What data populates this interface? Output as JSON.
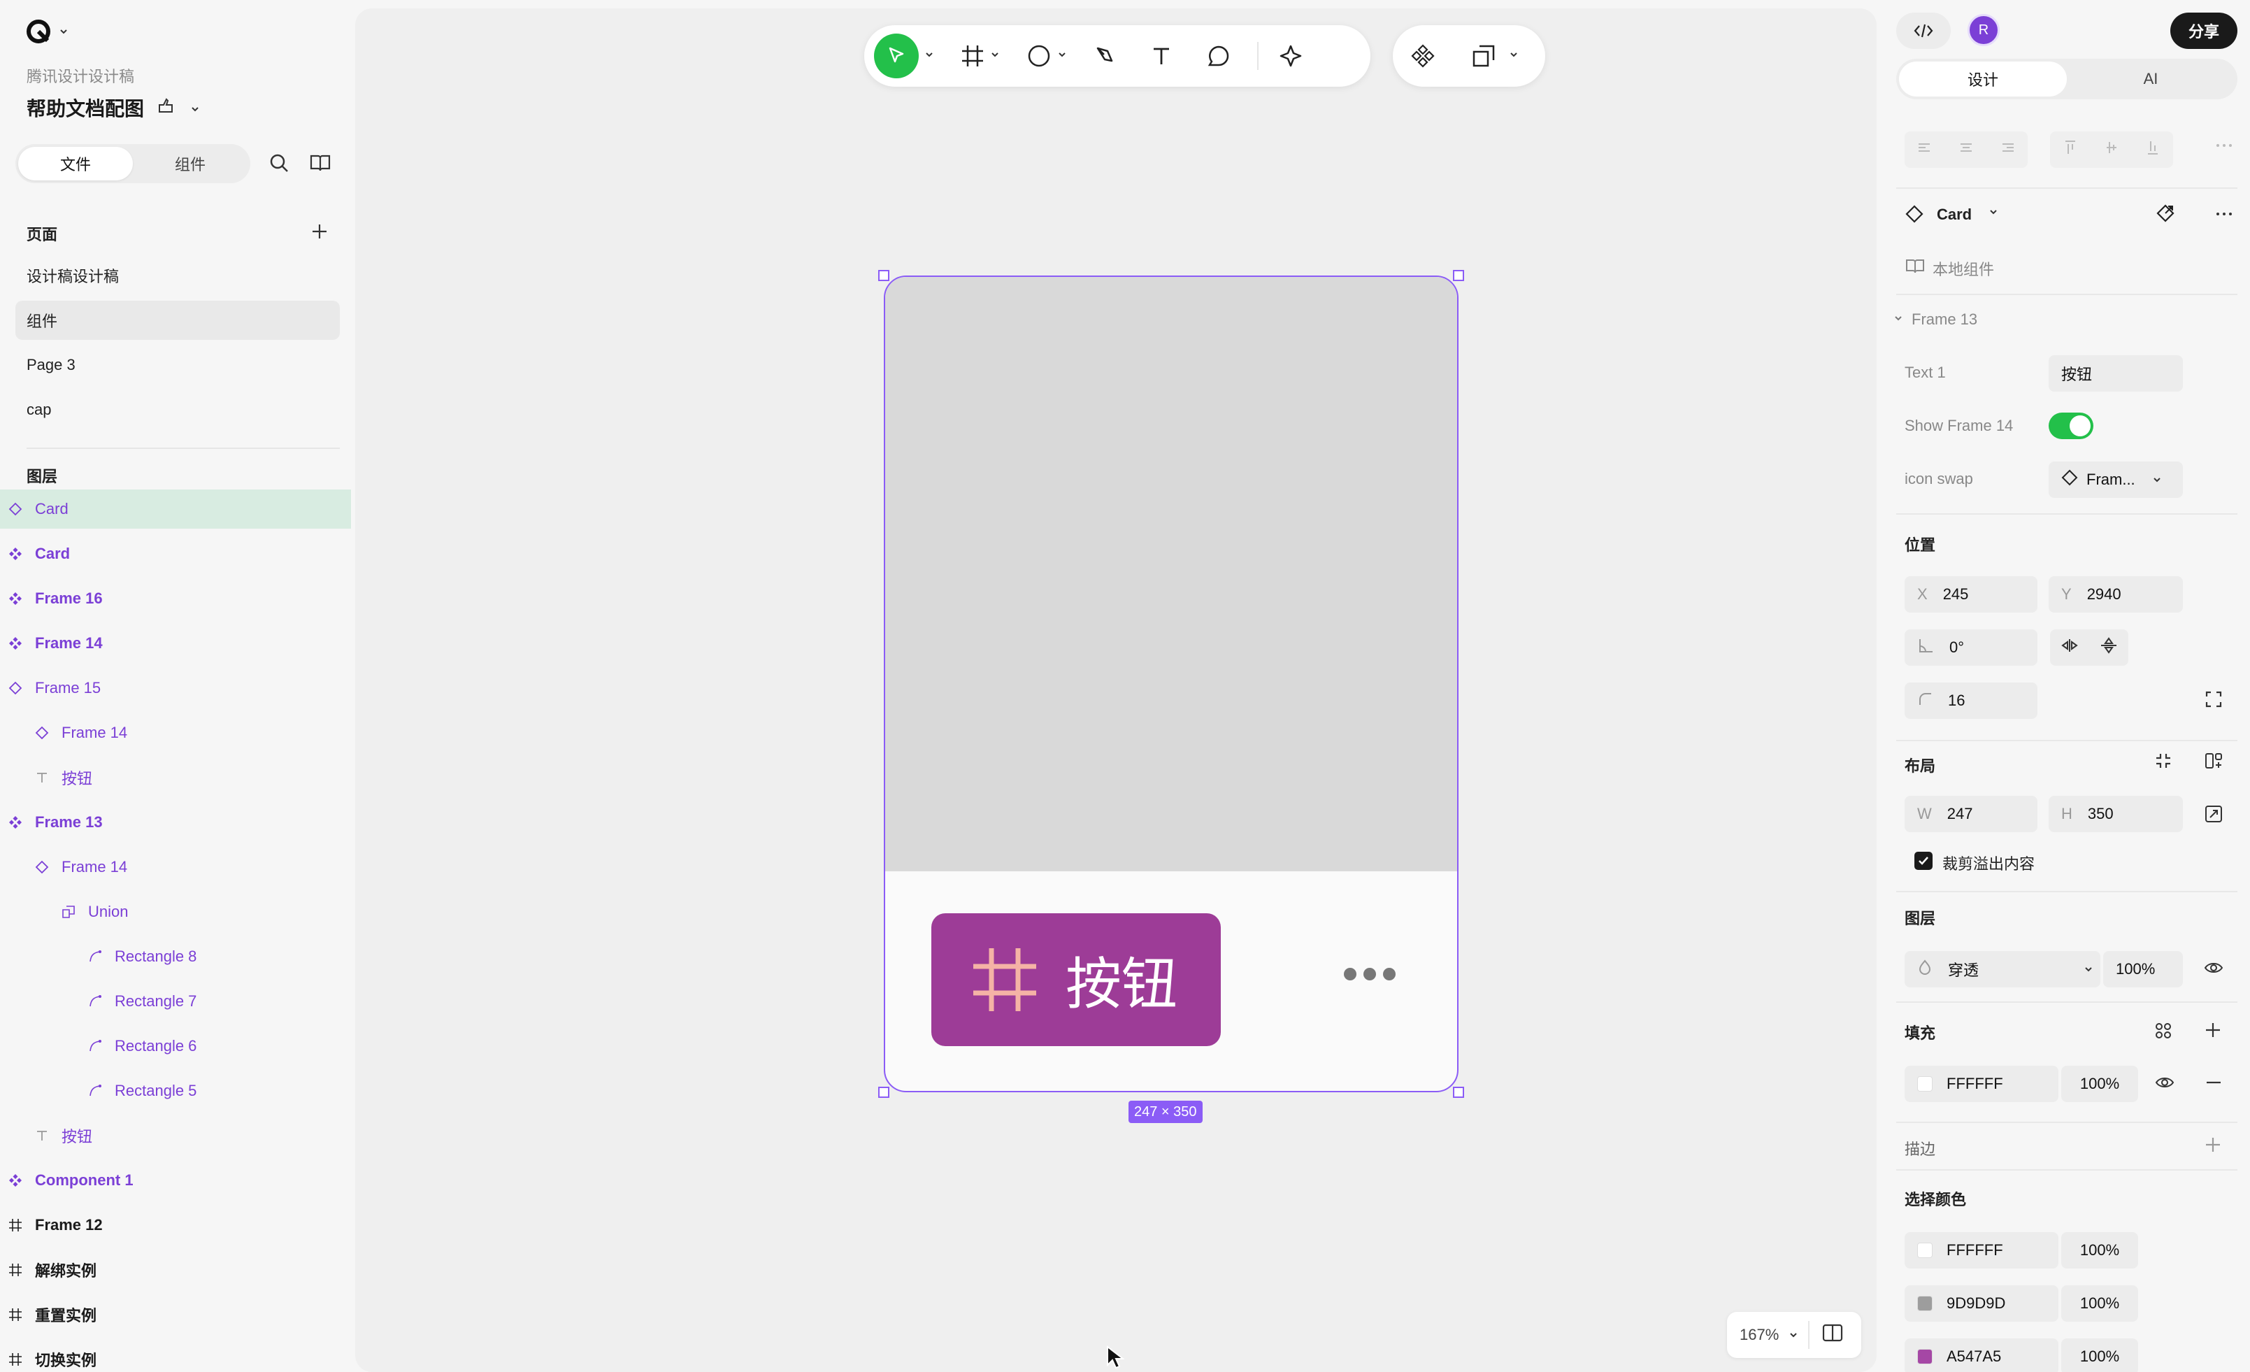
{
  "left": {
    "team": "腾讯设计设计稿",
    "document_title": "帮助文档配图",
    "tabs": [
      "文件",
      "组件"
    ],
    "pages_title": "页面",
    "pages": [
      "设计稿设计稿",
      "组件",
      "Page 3",
      "cap"
    ],
    "layers_title": "图层",
    "layers": [
      {
        "label": "Card",
        "icon": "instance-icon"
      },
      {
        "label": "Card",
        "icon": "component-icon"
      },
      {
        "label": "Frame 16",
        "icon": "component-icon"
      },
      {
        "label": "Frame 14",
        "icon": "component-icon"
      },
      {
        "label": "Frame 15",
        "icon": "instance-icon"
      },
      {
        "label": "Frame 14",
        "icon": "instance-icon"
      },
      {
        "label": "按钮",
        "icon": "text-icon"
      },
      {
        "label": "Frame 13",
        "icon": "component-icon"
      },
      {
        "label": "Frame 14",
        "icon": "instance-icon"
      },
      {
        "label": "Union",
        "icon": "union-icon"
      },
      {
        "label": "Rectangle 8",
        "icon": "vector-icon"
      },
      {
        "label": "Rectangle 7",
        "icon": "vector-icon"
      },
      {
        "label": "Rectangle 6",
        "icon": "vector-icon"
      },
      {
        "label": "Rectangle 5",
        "icon": "vector-icon"
      },
      {
        "label": "按钮",
        "icon": "text-icon"
      },
      {
        "label": "Component 1",
        "icon": "component-icon"
      },
      {
        "label": "Frame 12",
        "icon": "frame-icon"
      },
      {
        "label": "解绑实例",
        "icon": "frame-icon"
      },
      {
        "label": "重置实例",
        "icon": "frame-icon"
      },
      {
        "label": "切换实例",
        "icon": "frame-icon"
      }
    ]
  },
  "canvas": {
    "button_text": "按钮",
    "size_label": "247 × 350",
    "zoom": "167%",
    "colors": {
      "frame_top": "#D9D9D9",
      "button": "#9D3C97",
      "selection": "#8B5CF6"
    }
  },
  "right": {
    "share": "分享",
    "avatar": "R",
    "tabs": [
      "设计",
      "AI"
    ],
    "component_name": "Card",
    "local_component": "本地组件",
    "frame_group": "Frame 13",
    "props": {
      "text1_label": "Text 1",
      "text1_value": "按钮",
      "show_label": "Show Frame 14",
      "show_value": true,
      "swap_label": "icon swap",
      "swap_value": "Fram..."
    },
    "position_title": "位置",
    "x": "245",
    "y": "2940",
    "rotation": "0°",
    "radius": "16",
    "x_label": "X",
    "y_label": "Y",
    "layout_title": "布局",
    "w": "247",
    "h": "350",
    "w_label": "W",
    "h_label": "H",
    "clip_label": "裁剪溢出内容",
    "layer_title": "图层",
    "blend": "穿透",
    "opacity": "100%",
    "fill_title": "填充",
    "fill": {
      "hex": "FFFFFF",
      "opacity": "100%",
      "color": "#FFFFFF"
    },
    "stroke_title": "描边",
    "selection_colors_title": "选择颜色",
    "selection_colors": [
      {
        "hex": "FFFFFF",
        "opacity": "100%",
        "color": "#FFFFFF"
      },
      {
        "hex": "9D9D9D",
        "opacity": "100%",
        "color": "#9D9D9D"
      },
      {
        "hex": "A547A5",
        "opacity": "100%",
        "color": "#A547A5"
      }
    ]
  }
}
